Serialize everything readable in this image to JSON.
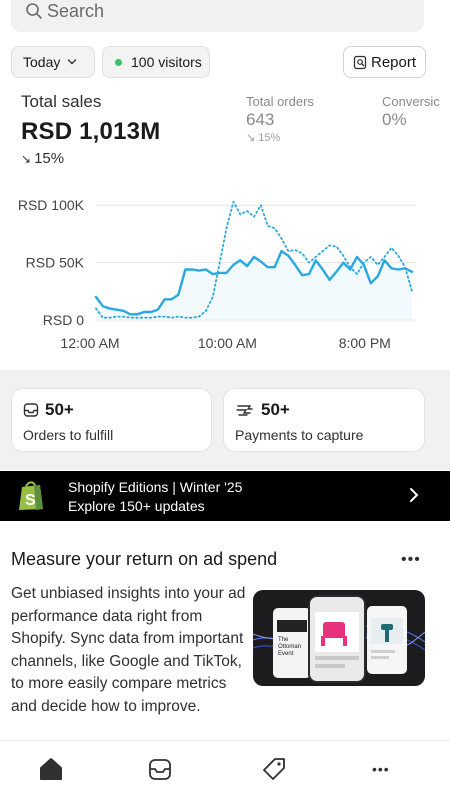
{
  "search": {
    "placeholder": "Search"
  },
  "filters": {
    "date_label": "Today",
    "visitors_label": "100 visitors",
    "report_label": "Report"
  },
  "metrics": {
    "total_sales": {
      "label": "Total sales",
      "value": "RSD 1,013M",
      "delta": "15%"
    },
    "total_orders": {
      "label": "Total orders",
      "value": "643",
      "delta": "15%"
    },
    "conversion": {
      "label": "Conversic",
      "value": "0%"
    }
  },
  "chart_data": {
    "type": "line",
    "x_ticks": [
      "12:00 AM",
      "10:00 AM",
      "8:00 PM"
    ],
    "y_ticks": [
      "RSD 100K",
      "RSD 50K",
      "RSD 0"
    ],
    "ylim": [
      0,
      115000
    ],
    "x": [
      0,
      0.5,
      1,
      1.5,
      2,
      2.5,
      3,
      3.5,
      4,
      4.5,
      5,
      5.5,
      6,
      6.5,
      7,
      7.5,
      8,
      8.5,
      9,
      9.5,
      10,
      10.5,
      11,
      11.5,
      12,
      12.5,
      13,
      13.5,
      14,
      14.5,
      15,
      15.5,
      16,
      16.5,
      17,
      17.5,
      18,
      18.5,
      19,
      19.5,
      20,
      20.5,
      21,
      21.5,
      22,
      22.5,
      23
    ],
    "series": [
      {
        "values": [
          20000,
          12000,
          10000,
          9000,
          8000,
          5000,
          5000,
          7000,
          7000,
          9000,
          18000,
          18000,
          22000,
          44000,
          44000,
          43000,
          44000,
          40000,
          41000,
          41000,
          48000,
          52000,
          47000,
          55000,
          51000,
          46000,
          46000,
          60000,
          56000,
          48000,
          39000,
          40000,
          52000,
          44000,
          35000,
          42000,
          50000,
          44000,
          55000,
          48000,
          32000,
          38000,
          52000,
          45000,
          44000,
          45000,
          42000
        ],
        "color": "#2aa8e0",
        "style": "solid"
      },
      {
        "values": [
          10000,
          2000,
          2000,
          3000,
          3000,
          2000,
          2000,
          2000,
          2000,
          3000,
          3000,
          2000,
          3000,
          2000,
          2000,
          3000,
          8000,
          20000,
          50000,
          80000,
          103000,
          92000,
          95000,
          90000,
          100000,
          82000,
          80000,
          71000,
          60000,
          61000,
          58000,
          50000,
          55000,
          60000,
          65000,
          64000,
          56000,
          46000,
          40000,
          50000,
          55000,
          48000,
          55000,
          63000,
          56000,
          46000,
          25000
        ],
        "color": "#2aa8e0",
        "style": "dotted"
      }
    ],
    "grid": true
  },
  "tasks": [
    {
      "count": "50+",
      "label": "Orders to fulfill"
    },
    {
      "count": "50+",
      "label": "Payments to capture"
    }
  ],
  "banner": {
    "line1": "Shopify Editions | Winter '25",
    "line2": "Explore 150+ updates"
  },
  "article": {
    "title": "Measure your return on ad spend",
    "more": "•••",
    "body": "Get unbiased insights into your ad performance data right from Shopify. Sync data from important channels, like Google and TikTok, to more easily compare metrics and decide how to improve.",
    "image_text": {
      "line1": "The",
      "line2": "Ottoman",
      "line3": "Event"
    }
  },
  "nav": {
    "items": [
      "home-icon",
      "orders-icon",
      "products-icon",
      "more-icon"
    ],
    "more_label": "•••"
  }
}
